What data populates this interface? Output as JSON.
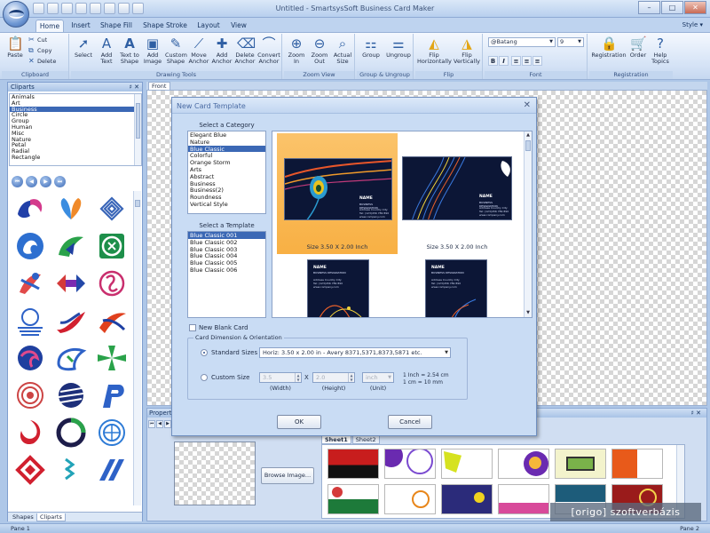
{
  "window": {
    "title": "Untitled - SmartsysSoft Business Card Maker",
    "min_glyph": "–",
    "max_glyph": "□",
    "close_glyph": "✕"
  },
  "ribbon": {
    "tabs": [
      "Home",
      "Insert",
      "Shape Fill",
      "Shape Stroke",
      "Layout",
      "View"
    ],
    "style_menu": "Style ▾",
    "clipboard": {
      "label": "Clipboard",
      "paste": "Paste",
      "cut": "Cut",
      "copy": "Copy",
      "delete": "Delete"
    },
    "drawing_tools": {
      "label": "Drawing Tools",
      "buttons": [
        "Select",
        "Add Text",
        "Text to Shape",
        "Add Image",
        "Custom Shape",
        "Move Anchor",
        "Add Anchor",
        "Delete Anchor",
        "Convert Anchor"
      ]
    },
    "zoom_view": {
      "label": "Zoom View",
      "buttons": [
        "Zoom In",
        "Zoom Out",
        "Actual Size"
      ]
    },
    "group_ungroup": {
      "label": "Group & Ungroup",
      "buttons": [
        "Group",
        "Ungroup"
      ]
    },
    "flip": {
      "label": "Flip",
      "buttons": [
        "Flip Horizontally",
        "Flip Vertically"
      ]
    },
    "font": {
      "label": "Font",
      "family": "@Batang",
      "size": "9",
      "format_buttons": [
        "B",
        "I",
        "≡",
        "≡",
        "≡"
      ]
    },
    "registration": {
      "label": "Registration",
      "buttons": [
        "Registration",
        "Order",
        "Help Topics"
      ]
    }
  },
  "cliparts_panel": {
    "title": "Cliparts",
    "pin": "♯ ✕",
    "categories": [
      "Animals",
      "Art",
      "Business",
      "Circle",
      "Group",
      "Human",
      "Misc",
      "Nature",
      "Petal",
      "Radial",
      "Rectangle"
    ],
    "selected_category": "Business",
    "nav": [
      "⏮",
      "◀",
      "▶",
      "⏭"
    ],
    "bottom_tabs": [
      "Shapes",
      "Cliparts"
    ],
    "active_bottom_tab": "Cliparts"
  },
  "document": {
    "tab": "Front"
  },
  "properties_panel": {
    "title": "Properties",
    "pin": "♯ ✕",
    "nav": [
      "⏮",
      "◀",
      "▶"
    ],
    "browse_button": "Browse Image...",
    "sheet_tabs": [
      "Sheet1",
      "Sheet2"
    ],
    "active_sheet": "Sheet1"
  },
  "status_bar": {
    "pane1": "Pane 1",
    "pane2": "Pane 2"
  },
  "dialog": {
    "title": "New Card Template",
    "close_glyph": "✕",
    "select_category_label": "Select a Category",
    "categories": [
      "Elegant Blue",
      "Nature",
      "Blue Classic",
      "Colorful",
      "Orange Storm",
      "Arts",
      "Abstract",
      "Business",
      "Business(2)",
      "Roundness",
      "Vertical Style"
    ],
    "selected_category": "Blue Classic",
    "select_template_label": "Select a Template",
    "templates": [
      "Blue Classic 001",
      "Blue Classic 002",
      "Blue Classic 003",
      "Blue Classic 004",
      "Blue Classic 005",
      "Blue Classic 006"
    ],
    "selected_template": "Blue Classic 001",
    "previews": [
      {
        "size": "Size 3.50 X 2.00 Inch",
        "name": "NAME",
        "subtitle": "BUSINESS DESIGNATION",
        "lines": [
          "Address Country City",
          "Tel: (123)456 789 890",
          "www.company.com"
        ]
      },
      {
        "size": "Size 3.50 X 2.00 Inch",
        "name": "NAME",
        "subtitle": "BUSINESS DESIGNATION",
        "lines": [
          "Address Country City",
          "Tel: (123)456 789 890",
          "www.company.com"
        ]
      },
      {
        "size": "",
        "name": "NAME",
        "subtitle": "BUSINESS DESIGNATION",
        "lines": [
          "Address Country City",
          "Tel: (123)456 789 890",
          "www.company.com"
        ]
      },
      {
        "size": "",
        "name": "NAME",
        "subtitle": "BUSINESS DESIGNATION",
        "lines": [
          "Address Country City",
          "Tel: (123)456 789 890",
          "www.company.com"
        ]
      }
    ],
    "new_blank_card": "New Blank Card",
    "dimension_group": "Card Dimension & Orientation",
    "standard_sizes_label": "Standard Sizes",
    "standard_size_value": "Horiz: 3.50 x 2.00 in - Avery 8371,5371,8373,5871 etc.",
    "custom_size_label": "Custom Size",
    "width_value": "3.5",
    "height_value": "2.0",
    "unit_value": "inch",
    "times_glyph": "X",
    "width_label": "(Width)",
    "height_label": "(Height)",
    "unit_label": "(Unit)",
    "conversion_1": "1 Inch = 2.54 cm",
    "conversion_2": "1 cm = 10 mm",
    "ok_button": "OK",
    "cancel_button": "Cancel"
  },
  "watermark": "[origo] szoftverbázis",
  "colors": {
    "accent": "#3b68b5",
    "ribbon_bg": "#d5e3f6",
    "dialog_bg": "#c9dcf4",
    "selected_preview": "#f8b044",
    "card_dark": "#0c1636"
  }
}
